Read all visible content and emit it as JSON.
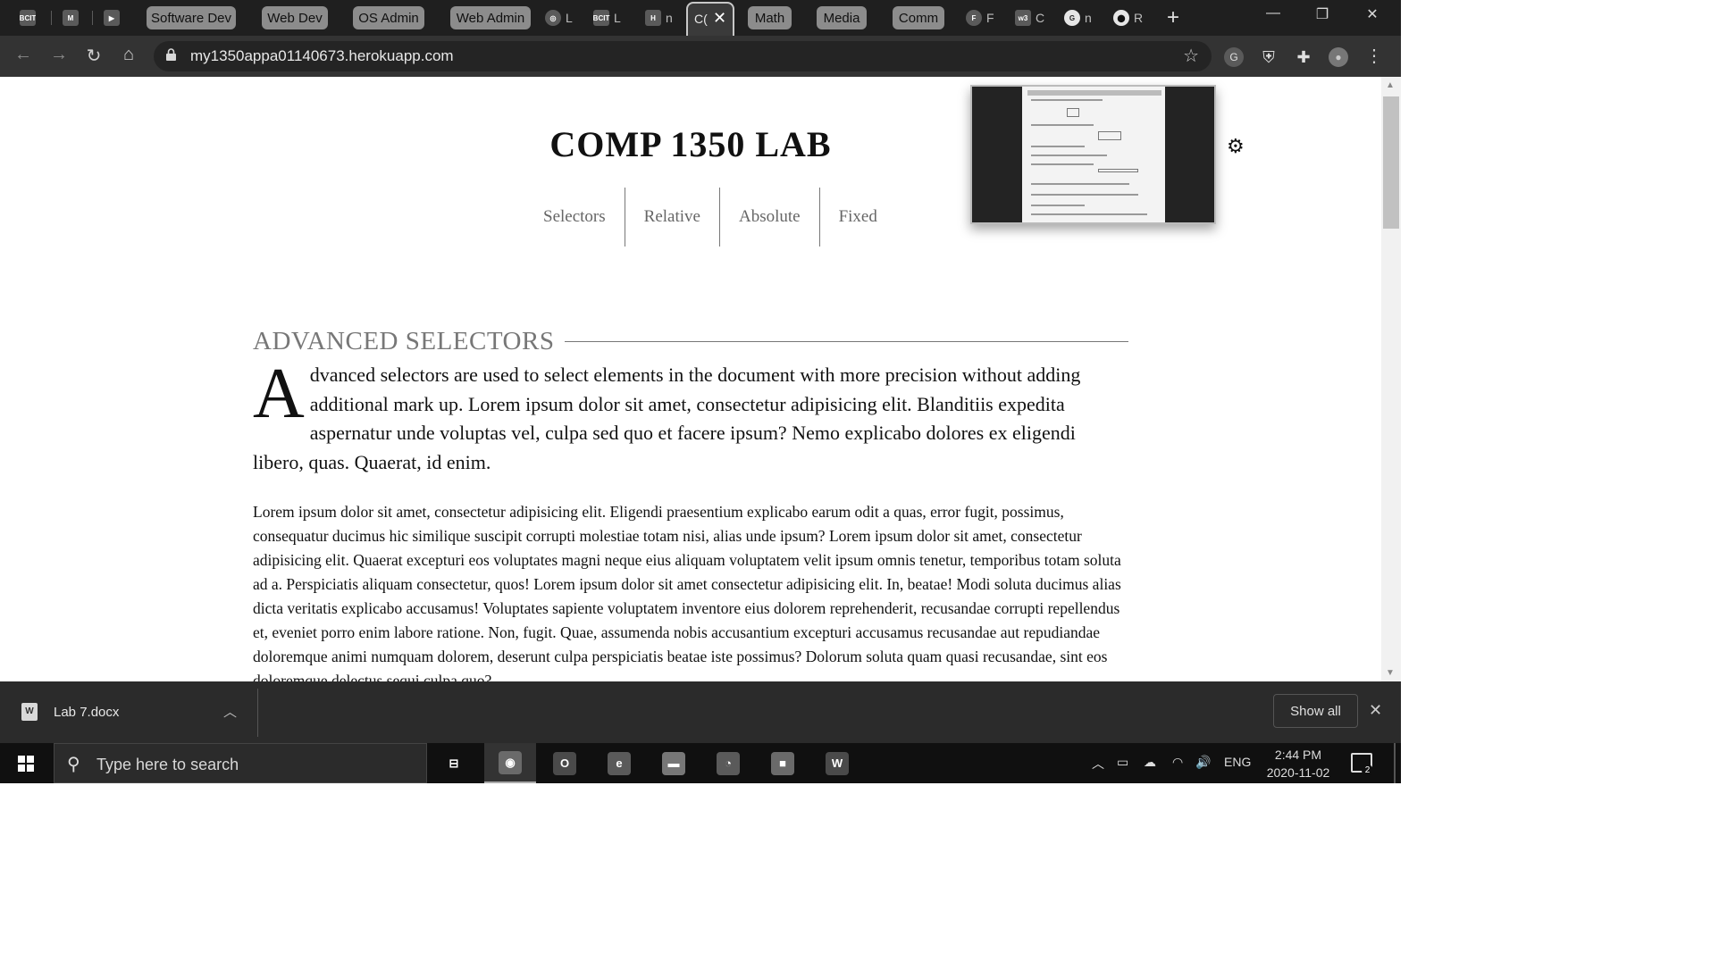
{
  "browser": {
    "tabs": [
      {
        "icon": "bcit-icon",
        "badge": "BCIT",
        "title": ""
      },
      {
        "icon": "gmail-icon",
        "badge": "M",
        "title": ""
      },
      {
        "icon": "youtube-icon",
        "badge": "▶",
        "title": ""
      }
    ],
    "tab_groups": [
      "Software Dev",
      "Web Dev",
      "OS Admin",
      "Web Admin"
    ],
    "mid_tabs": [
      {
        "icon": "globe-icon",
        "badge": "◎",
        "title": "L"
      },
      {
        "icon": "bcit-icon",
        "badge": "BCIT",
        "title": "L"
      },
      {
        "icon": "heroku-icon",
        "badge": "H",
        "title": "n"
      }
    ],
    "active_tab": {
      "title": "C(",
      "close": "✕"
    },
    "tab_groups_right": [
      "Math",
      "Media",
      "Comm"
    ],
    "right_tabs": [
      {
        "icon": "f-icon",
        "badge": "F",
        "title": "F"
      },
      {
        "icon": "w3-icon",
        "badge": "w3",
        "title": "C"
      },
      {
        "icon": "grammarly-icon",
        "badge": "G",
        "title": "n"
      },
      {
        "icon": "github-icon",
        "badge": "⬤",
        "title": "R"
      }
    ],
    "new_tab": "+",
    "window": {
      "minimize": "—",
      "restore": "❐",
      "close": "✕"
    },
    "nav": {
      "back": "←",
      "forward": "→",
      "reload": "↻",
      "home": "⌂"
    },
    "url": "my1350appa01140673.herokuapp.com",
    "star": "☆",
    "extensions": [
      {
        "name": "grammarly-ext-icon",
        "glyph": "G"
      },
      {
        "name": "shield-ext-icon",
        "glyph": "⛨"
      },
      {
        "name": "puzzle-ext-icon",
        "glyph": "✚"
      },
      {
        "name": "profile-avatar-icon",
        "glyph": "●"
      }
    ],
    "menu": "⋮"
  },
  "page": {
    "title": "COMP 1350 LAB",
    "nav": [
      "Selectors",
      "Relative",
      "Absolute",
      "Fixed"
    ],
    "gear": "⚙",
    "section_heading": "ADVANCED SELECTORS",
    "dropcap": "A",
    "lead": "dvanced selectors are used to select elements in the document with more precision without adding additional mark up. Lorem ipsum dolor sit amet, consectetur adipisicing elit. Blanditiis expedita aspernatur unde voluptas vel, culpa sed quo et facere ipsum? Nemo explicabo dolores ex eligendi libero, quas. Quaerat, id enim.",
    "body": "Lorem ipsum dolor sit amet, consectetur adipisicing elit. Eligendi praesentium explicabo earum odit a quas, error fugit, possimus, consequatur ducimus hic similique suscipit corrupti molestiae totam nisi, alias unde ipsum? Lorem ipsum dolor sit amet, consectetur adipisicing elit. Quaerat excepturi eos voluptates magni neque eius aliquam voluptatem velit ipsum omnis tenetur, temporibus totam soluta ad a. Perspiciatis aliquam consectetur, quos! Lorem ipsum dolor sit amet consectetur adipisicing elit. In, beatae! Modi soluta ducimus alias dicta veritatis explicabo accusamus! Voluptates sapiente voluptatem inventore eius dolorem reprehenderit, recusandae corrupti repellendus et, eveniet porro enim labore ratione. Non, fugit. Quae, assumenda nobis accusantium excepturi accusamus recusandae aut repudiandae doloremque animi numquam dolorem, deserunt culpa perspiciatis beatae iste possimus? Dolorum soluta quam quasi recusandae, sint eos doloremque delectus sequi culpa quo?"
  },
  "downloads": {
    "file_icon": "W",
    "file": "Lab 7.docx",
    "chevron": "︿",
    "show_all": "Show all",
    "close": "✕"
  },
  "taskbar": {
    "search_placeholder": "Type here to search",
    "search_glyph": "⚲",
    "apps": [
      {
        "name": "task-view-icon",
        "glyph": "⊟",
        "bg": "transparent",
        "active": false
      },
      {
        "name": "chrome-icon",
        "glyph": "◉",
        "bg": "#6a6a6a",
        "active": true
      },
      {
        "name": "outlook-icon",
        "glyph": "O",
        "bg": "#4a4a4a",
        "active": false
      },
      {
        "name": "edge-icon",
        "glyph": "e",
        "bg": "#5a5a5a",
        "active": false
      },
      {
        "name": "file-explorer-icon",
        "glyph": "▬",
        "bg": "#777777",
        "active": false
      },
      {
        "name": "discord-icon",
        "glyph": "◔",
        "bg": "#5a5a5a",
        "active": false
      },
      {
        "name": "zoom-icon",
        "glyph": "■",
        "bg": "#6a6a6a",
        "active": false
      },
      {
        "name": "word-icon",
        "glyph": "W",
        "bg": "#4a4a4a",
        "active": false
      }
    ],
    "tray": {
      "chevron": "︿",
      "battery": "▭",
      "cloud": "☁",
      "wifi": "◠",
      "volume": "🔊",
      "language": "ENG"
    },
    "time": "2:44 PM",
    "date": "2020-11-02",
    "notifications": "2"
  }
}
